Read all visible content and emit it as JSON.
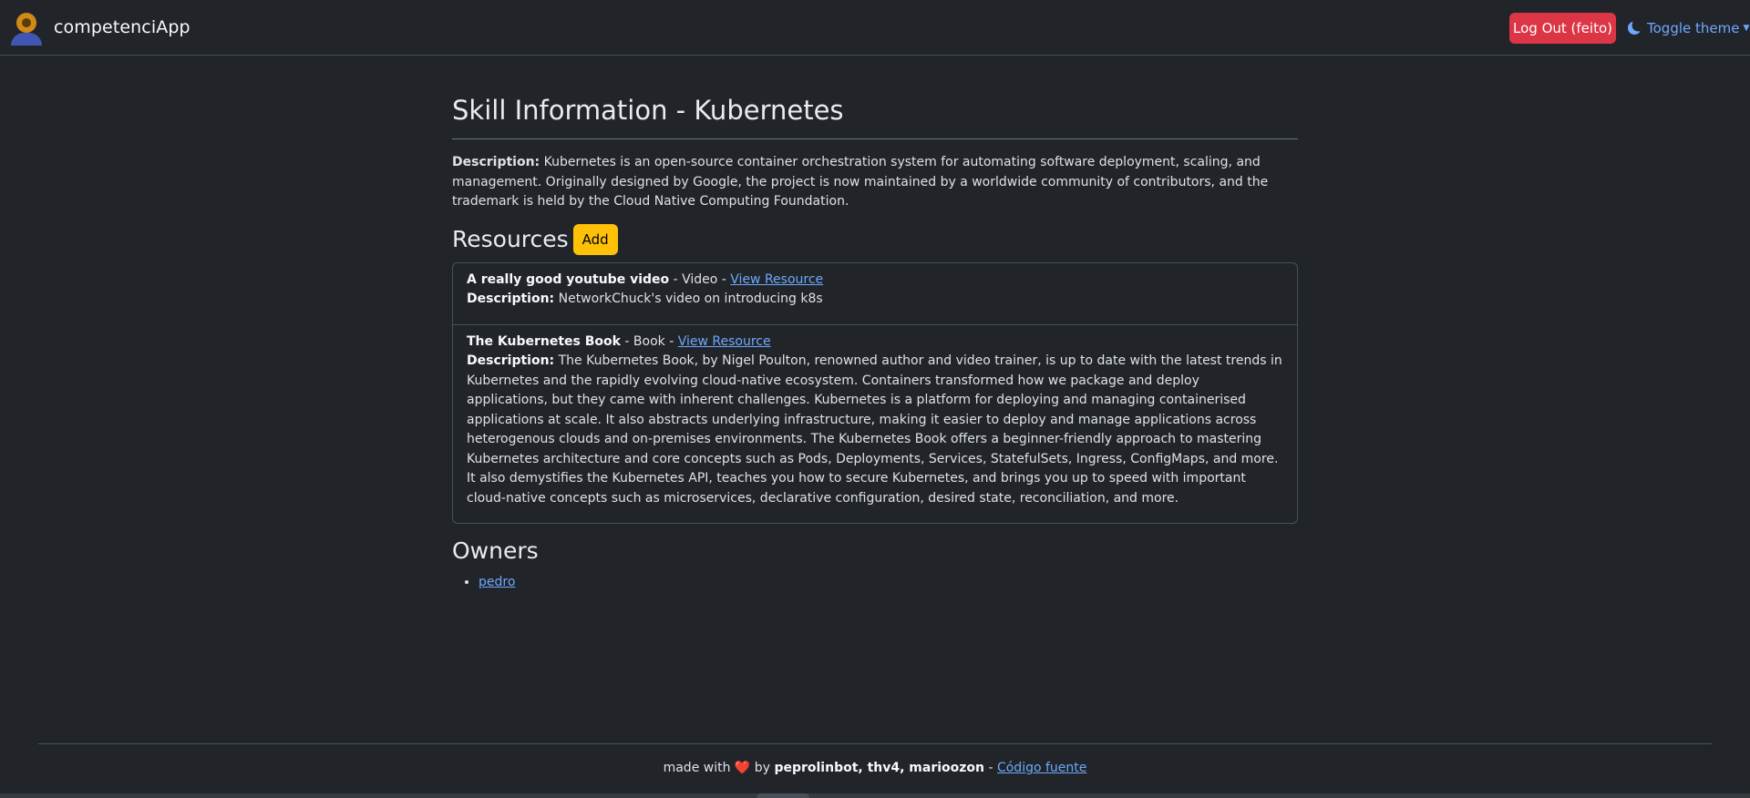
{
  "navbar": {
    "brand": "competenciApp",
    "logout_label": "Log Out (feito)",
    "theme_toggle_label": "Toggle theme",
    "logo_icon": "user-avatar-icon",
    "theme_icon": "moon-icon"
  },
  "page": {
    "title": "Skill Information - Kubernetes",
    "description_label": "Description:",
    "description": "Kubernetes is an open-source container orchestration system for automating software deployment, scaling, and management. Originally designed by Google, the project is now maintained by a worldwide community of contributors, and the trademark is held by the Cloud Native Computing Foundation."
  },
  "resources": {
    "title": "Resources",
    "add_label": "Add",
    "items": [
      {
        "name": "A really good youtube video",
        "type_text": " - Video - ",
        "link_label": "View Resource",
        "description_label": "Description:",
        "description": "NetworkChuck's video on introducing k8s"
      },
      {
        "name": "The Kubernetes Book",
        "type_text": " - Book - ",
        "link_label": "View Resource",
        "description_label": "Description:",
        "description": "The Kubernetes Book, by Nigel Poulton, renowned author and video trainer, is up to date with the latest trends in Kubernetes and the rapidly evolving cloud-native ecosystem. Containers transformed how we package and deploy applications, but they came with inherent challenges. Kubernetes is a platform for deploying and managing containerised applications at scale. It also abstracts underlying infrastructure, making it easier to deploy and manage applications across heterogenous clouds and on-premises environments. The Kubernetes Book offers a beginner-friendly approach to mastering Kubernetes architecture and core concepts such as Pods, Deployments, Services, StatefulSets, Ingress, ConfigMaps, and more. It also demystifies the Kubernetes API, teaches you how to secure Kubernetes, and brings you up to speed with important cloud-native concepts such as microservices, declarative configuration, desired state, reconciliation, and more."
      }
    ]
  },
  "owners": {
    "title": "Owners",
    "items": [
      "pedro"
    ]
  },
  "footer": {
    "prefix": "made with ",
    "heart": "❤️",
    "by": " by ",
    "authors": "peprolinbot, thv4, marioozon",
    "separator": " - ",
    "source_label": "Código fuente"
  }
}
